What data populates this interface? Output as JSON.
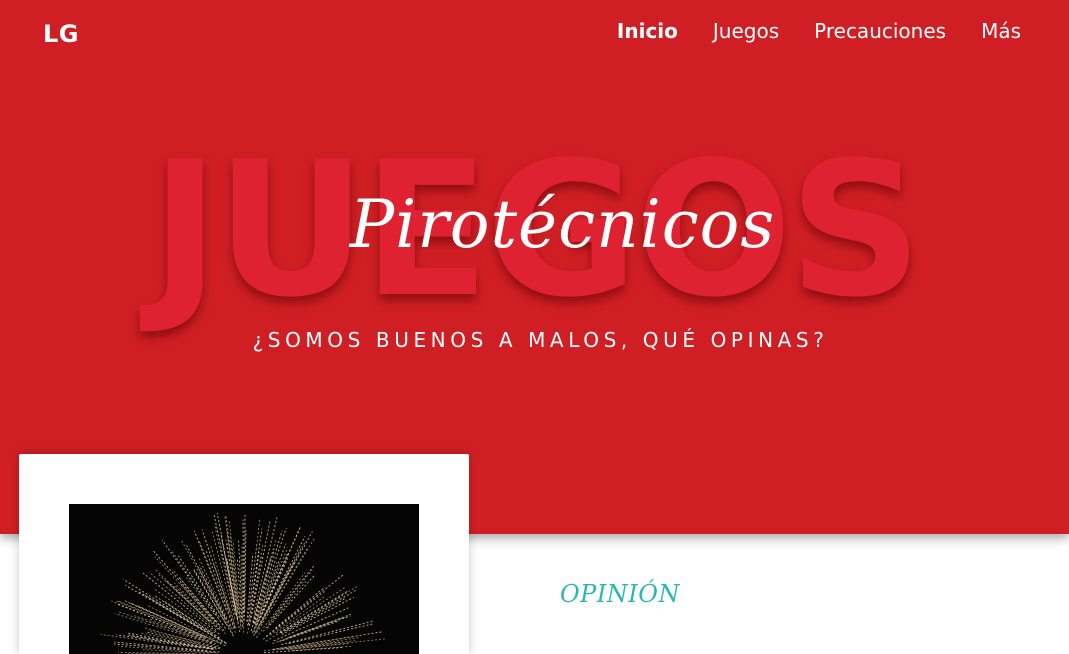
{
  "header": {
    "logo": "LG",
    "nav": {
      "inicio": "Inicio",
      "juegos": "Juegos",
      "precauciones": "Precauciones",
      "mas": "Más"
    }
  },
  "hero": {
    "background_word": "JUEGOS",
    "script_word": "Pirotécnicos",
    "tagline": "¿SOMOS BUENOS A MALOS, QUÉ OPINAS?"
  },
  "section": {
    "opinion_label": "OPINIÓN"
  },
  "colors": {
    "hero_red": "#cf1f24",
    "word_red": "#de2232",
    "accent_teal": "#2ab7b4"
  },
  "icons": {
    "photo": "fireworks-image"
  }
}
